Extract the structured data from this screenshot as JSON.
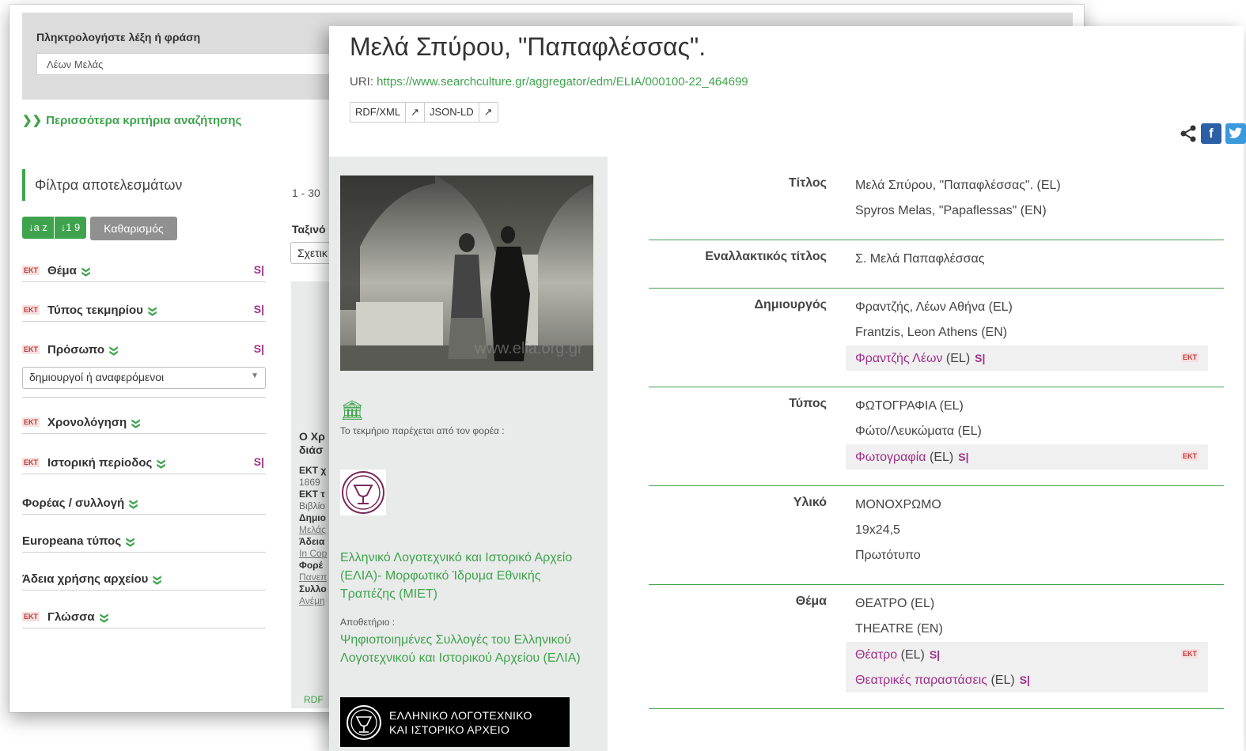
{
  "search": {
    "label": "Πληκτρολογήστε λέξη ή φράση",
    "value": "Λέων Μελάς",
    "more_criteria": "Περισσότερα κριτήρια αναζήτησης"
  },
  "filters": {
    "title": "Φίλτρα αποτελεσμάτων",
    "sort_az": "↓a z",
    "sort_19": "↓1 9",
    "clear": "Καθαρισμός",
    "ekt_badge": "EKT",
    "s_icon": "S|",
    "facets": [
      {
        "name": "Θέμα",
        "ekt": true,
        "s": true
      },
      {
        "name": "Τύπος τεκμηρίου",
        "ekt": true,
        "s": true
      },
      {
        "name": "Πρόσωπο",
        "ekt": true,
        "s": true,
        "select": "δημιουργοί ή αναφερόμενοι"
      },
      {
        "name": "Χρονολόγηση",
        "ekt": true,
        "s": false
      },
      {
        "name": "Ιστορική περίοδος",
        "ekt": true,
        "s": true
      },
      {
        "name": "Φορέας / συλλογή",
        "ekt": false,
        "s": false
      },
      {
        "name": "Europeana τύπος",
        "ekt": false,
        "s": false
      },
      {
        "name": "Άδεια χρήσης αρχείου",
        "ekt": false,
        "s": false
      },
      {
        "name": "Γλώσσα",
        "ekt": true,
        "s": false
      }
    ]
  },
  "results": {
    "range": "1 - 30",
    "sort_label": "Ταξινό",
    "sort_value": "Σχετικ",
    "card_title": [
      "Ο Χρ",
      "διάσ"
    ],
    "card_lines": [
      {
        "k": "ΕΚΤ χ",
        "v": "1869"
      },
      {
        "k": "ΕΚΤ τ",
        "v": "Βιβλίο"
      },
      {
        "k": "Δημιο",
        "v": "Μελάς"
      },
      {
        "k": "Άδεια",
        "v": "In Cop"
      },
      {
        "k": "Φορέ",
        "v": "Πανεπ"
      },
      {
        "k": "Συλλο",
        "v": "Ανέμη"
      }
    ],
    "footer": "RDF"
  },
  "record": {
    "title": "Μελά Σπύρου, \"Παπαφλέσσας\".",
    "uri_label": "URI:",
    "uri": "https://www.searchculture.gr/aggregator/edm/ELIA/000100-22_464699",
    "formats": [
      "RDF/XML",
      "↗",
      "JSON-LD",
      "↗"
    ],
    "share": {
      "share_icon": "share-icon",
      "fb": "f",
      "tw": "t"
    }
  },
  "provider": {
    "intro": "Το τεκμήριο παρέχεται από τον φορέα :",
    "name": "Ελληνικό Λογοτεχνικό και Ιστορικό Αρχείο (ΕΛΙΑ)- Μορφωτικό Ίδρυμα Εθνικής Τραπέζης (ΜΙΕΤ)",
    "repo_label": "Αποθετήριο :",
    "repo_name": "Ψηφιοποιημένες Συλλογές του Ελληνικού Λογοτεχνικού και Ιστορικού Αρχείου (ΕΛΙΑ)",
    "banner_line1": "ΕΛΛΗΝΙΚΟ ΛΟΓΟΤΕΧΝΙΚΟ",
    "banner_line2": "ΚΑΙ ΙΣΤΟΡΙΚΟ ΑΡΧΕΙΟ",
    "watermark": "www.elia.org.gr"
  },
  "metadata": [
    {
      "key": "Τίτλος",
      "values": [
        "Μελά Σπύρου, \"Παπαφλέσσας\". (EL)",
        "Spyros Melas, \"Papaflessas\" (EN)"
      ],
      "links": []
    },
    {
      "key": "Εναλλακτικός τίτλος",
      "values": [
        "Σ. Μελά Παπαφλέσσας"
      ],
      "links": []
    },
    {
      "key": "Δημιουργός",
      "values": [
        "Φραντζής, Λέων Αθήνα (EL)",
        "Frantzis, Leon Athens (EN)"
      ],
      "links": [
        {
          "label": "Φραντζής Λέων",
          "lang": "(EL)"
        }
      ]
    },
    {
      "key": "Τύπος",
      "values": [
        "ΦΩΤΟΓΡΑΦΙΑ (EL)",
        "Φώτο/Λευκώματα (EL)"
      ],
      "links": [
        {
          "label": "Φωτογραφία",
          "lang": "(EL)"
        }
      ]
    },
    {
      "key": "Υλικό",
      "values": [
        "ΜΟΝΟΧΡΩΜΟ",
        "19x24,5",
        "Πρωτότυπο"
      ],
      "links": []
    },
    {
      "key": "Θέμα",
      "values": [
        "ΘΕΑΤΡΟ (EL)",
        "THEATRE (EN)"
      ],
      "links": [
        {
          "label": "Θέατρο",
          "lang": "(EL)"
        },
        {
          "label": "Θεατρικές παραστάσεις",
          "lang": "(EL)"
        }
      ]
    }
  ]
}
